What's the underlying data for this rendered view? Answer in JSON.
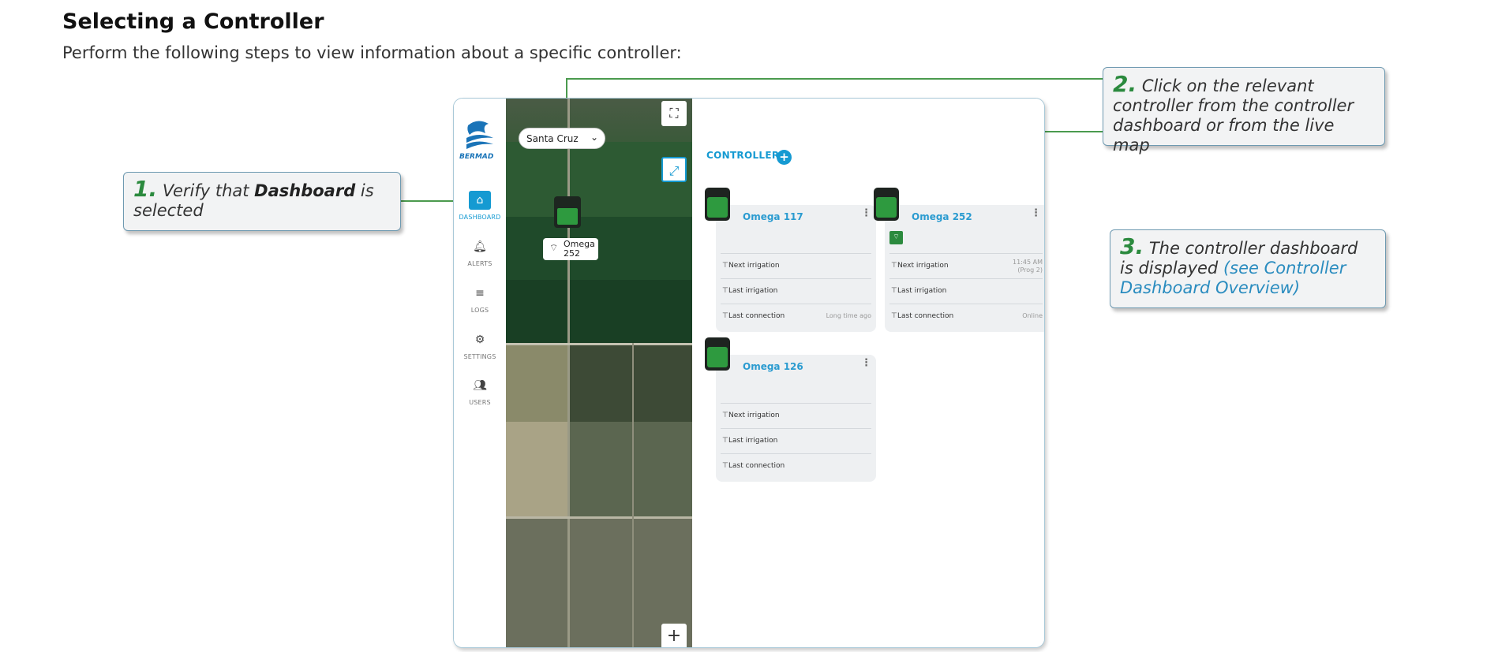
{
  "document": {
    "title": "Selecting a Controller",
    "intro": "Perform the following steps to view information about a specific controller:"
  },
  "callouts": [
    {
      "number": "1.",
      "text_before": "Verify that ",
      "bold": "Dashboard",
      "text_after": " is selected"
    },
    {
      "number": "2.",
      "text": "Click on the relevant controller from the controller dashboard or from the live map"
    },
    {
      "number": "3.",
      "text": "The controller dashboard is displayed ",
      "link": "(see Controller Dashboard Overview)"
    }
  ],
  "app": {
    "logo_text": "BERMAD",
    "sidebar": [
      {
        "label": "DASHBOARD",
        "icon": "home-icon",
        "active": true
      },
      {
        "label": "ALERTS",
        "icon": "bell-icon",
        "active": false
      },
      {
        "label": "LOGS",
        "icon": "list-icon",
        "active": false
      },
      {
        "label": "SETTINGS",
        "icon": "gear-icon",
        "active": false
      },
      {
        "label": "USERS",
        "icon": "users-icon",
        "active": false
      }
    ],
    "map": {
      "location_select": "Santa Cruz",
      "marker_label": "Omega 252",
      "marker_line1": "Omega",
      "marker_line2": "252"
    },
    "dashboard": {
      "heading": "CONTROLLERS",
      "controllers": [
        {
          "name": "Omega 117",
          "rows": [
            {
              "label": "Next irrigation",
              "value": ""
            },
            {
              "label": "Last irrigation",
              "value": ""
            },
            {
              "label": "Last connection",
              "value": "Long time ago"
            }
          ]
        },
        {
          "name": "Omega 252",
          "rows": [
            {
              "label": "Next irrigation",
              "value": "11:45 AM",
              "value2": "(Prog 2)"
            },
            {
              "label": "Last irrigation",
              "value": ""
            },
            {
              "label": "Last connection",
              "value": "Online"
            }
          ]
        },
        {
          "name": "Omega 126",
          "rows": [
            {
              "label": "Next irrigation",
              "value": ""
            },
            {
              "label": "Last irrigation",
              "value": ""
            },
            {
              "label": "Last connection",
              "value": ""
            }
          ]
        }
      ]
    }
  },
  "colors": {
    "accent": "#159ad2",
    "step_number": "#2b8a3e",
    "leader_line": "#4b9a4e",
    "controller_screen": "#2e9a3f"
  }
}
